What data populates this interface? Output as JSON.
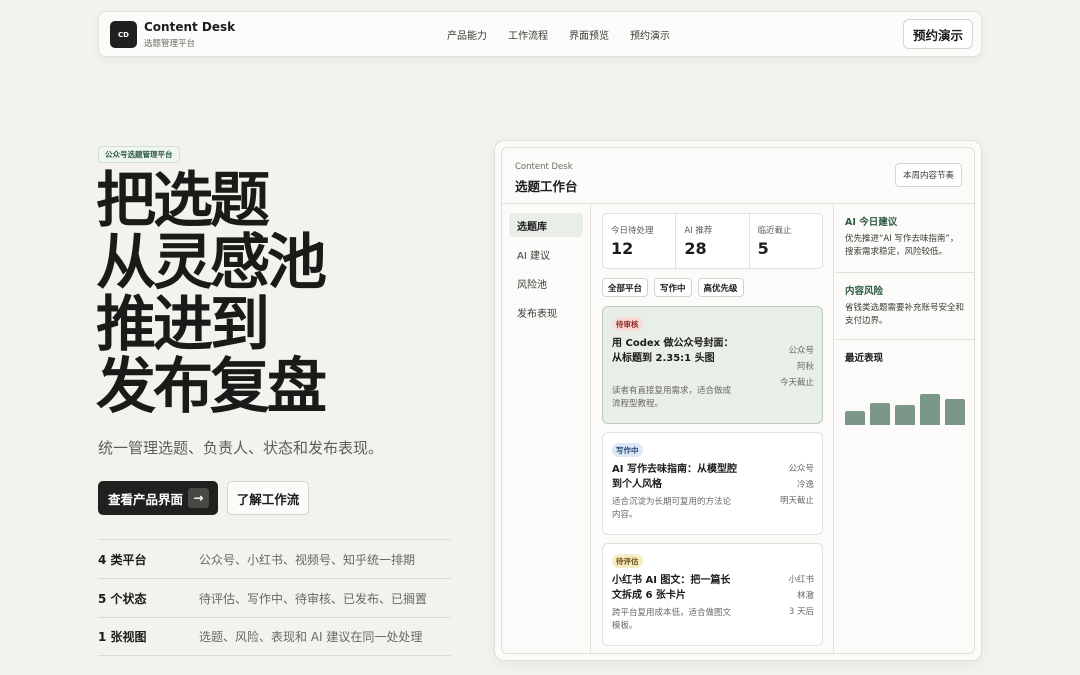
{
  "nav": {
    "logo_text": "CD",
    "brand": "Content Desk",
    "brand_sub": "选题管理平台",
    "links": [
      "产品能力",
      "工作流程",
      "界面预览",
      "预约演示"
    ],
    "cta": "预约演示"
  },
  "hero": {
    "tag": "公众号选题管理平台",
    "title_lines": [
      "把选题",
      "从灵感池",
      "推进到",
      "发布复盘"
    ],
    "subtitle": "统一管理选题、负责人、状态和发布表现。",
    "primary_button": "查看产品界面",
    "primary_arrow": "→",
    "secondary_button": "了解工作流",
    "stats": [
      {
        "key": "4 类平台",
        "value": "公众号、小红书、视频号、知乎统一排期"
      },
      {
        "key": "5 个状态",
        "value": "待评估、写作中、待审核、已发布、已搁置"
      },
      {
        "key": "1 张视图",
        "value": "选题、风险、表现和 AI 建议在同一处处理"
      }
    ]
  },
  "panel": {
    "small": "Content Desk",
    "title": "选题工作台",
    "header_button": "本周内容节奏",
    "sidebar": [
      "选题库",
      "AI 建议",
      "风险池",
      "发布表现"
    ],
    "kpis": [
      {
        "label": "今日待处理",
        "value": "12"
      },
      {
        "label": "AI 推荐",
        "value": "28"
      },
      {
        "label": "临近截止",
        "value": "5"
      }
    ],
    "filters": [
      "全部平台",
      "写作中",
      "高优先级"
    ],
    "cards": [
      {
        "badge": "待审核",
        "title": "用 Codex 做公众号封面：从标题到 2.35:1 头图",
        "desc": "读者有直接复用需求，适合做成流程型教程。",
        "platform": "公众号",
        "owner": "阿秋",
        "due": "今天截止"
      },
      {
        "badge": "写作中",
        "title": "AI 写作去味指南：从模型腔到个人风格",
        "desc": "适合沉淀为长期可复用的方法论内容。",
        "platform": "公众号",
        "owner": "冷逸",
        "due": "明天截止"
      },
      {
        "badge": "待评估",
        "title": "小红书 AI 图文：把一篇长文拆成 6 张卡片",
        "desc": "跨平台复用成本低，适合做图文模板。",
        "platform": "小红书",
        "owner": "林澈",
        "due": "3 天后"
      }
    ],
    "right": {
      "ai_head": "AI 今日建议",
      "ai_text": "优先推进“AI 写作去味指南”，搜索需求稳定，风险较低。",
      "risk_head": "内容风险",
      "risk_text": "省钱类选题需要补充账号安全和支付边界。",
      "perf_head": "最近表现",
      "perf_values": [
        0.45,
        0.72,
        0.65,
        1.0,
        0.85
      ]
    },
    "colors": {
      "accent": "#2d5a42",
      "bar": "#7c968a",
      "dark": "#1f211e"
    }
  }
}
